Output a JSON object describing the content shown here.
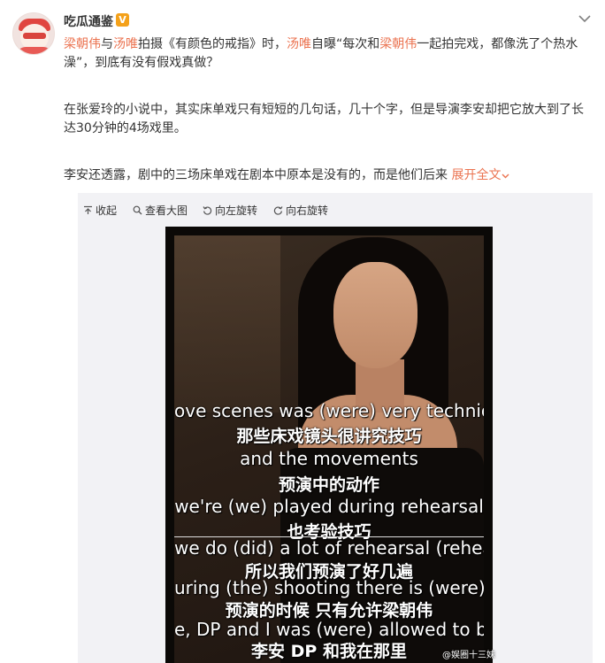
{
  "post": {
    "username": "吃瓜通鉴",
    "vip_badge": "V",
    "paragraph1": {
      "p1": "梁朝伟",
      "p2": "与",
      "p3": "汤唯",
      "p4": "拍摄《有颜色的戒指》时，",
      "p5": "汤唯",
      "p6": "自曝“每次和",
      "p7": "梁朝伟",
      "p8": "一起拍完戏，都像洗了个热水澡”，到底有没有假戏真做？"
    },
    "paragraph2": "在张爱玲的小说中，其实床单戏只有短短的几句话，几十个字，但是导演李安却把它放大到了长达30分钟的4场戏里。",
    "paragraph3": "李安还透露，剧中的三场床单戏在剧本中原本是没有的，而是他们后来",
    "expand_label": "展开全文"
  },
  "toolbar": {
    "collapse": "收起",
    "view_large": "查看大图",
    "rotate_left": "向左旋转",
    "rotate_right": "向右旋转"
  },
  "image": {
    "subtitles": [
      {
        "en": "ove scenes was (were) very technic",
        "zh": "那些床戏镜头很讲究技巧"
      },
      {
        "en": "and the movements",
        "zh": "预演中的动作"
      },
      {
        "en": "we're (we) played during rehearsal",
        "zh": "也考验技巧"
      },
      {
        "en": "we do (did) a lot of rehearsal (rehearsals",
        "zh": "所以我们预演了好几遍"
      },
      {
        "en": "uring (the) shooting  there is (were) only Ton",
        "zh": "预演的时候 只有允许梁朝伟"
      },
      {
        "en": "e, DP and I was (were) allowed to be there",
        "zh": "李安  DP  和我在那里"
      }
    ],
    "watermark": "@娱圈十三妹"
  },
  "colors": {
    "highlight": "#eb7350",
    "panel_bg": "#f2f2f5",
    "text": "#333333"
  },
  "icons": [
    "avatar-image",
    "vip-badge-icon",
    "chevron-down-icon",
    "collapse-icon",
    "magnifier-icon",
    "rotate-left-icon",
    "rotate-right-icon"
  ]
}
